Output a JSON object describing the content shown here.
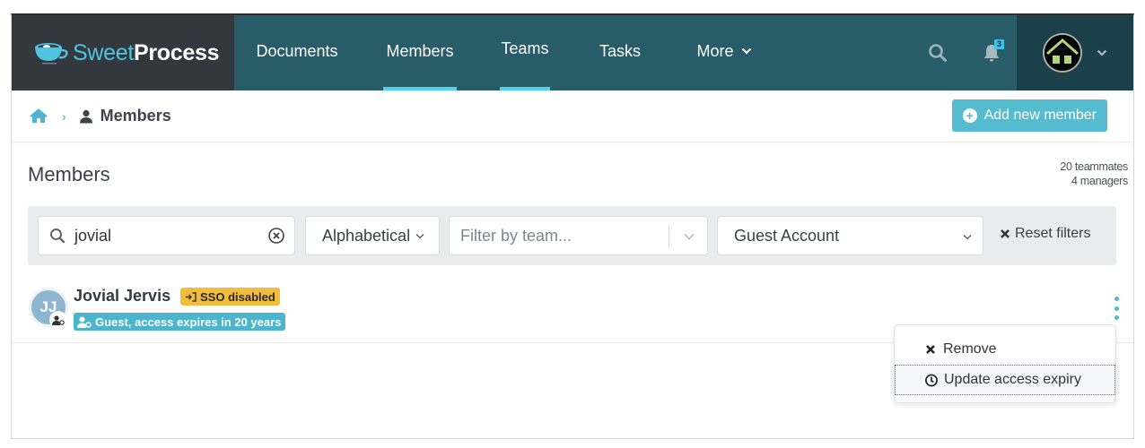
{
  "brand": {
    "name_light": "Sweet",
    "name_bold": "Process",
    "logo_icon": "coffee-cup-icon"
  },
  "nav": {
    "items": [
      {
        "label": "Documents",
        "active": false
      },
      {
        "label": "Members",
        "active": true
      },
      {
        "label": "Teams",
        "active": true
      },
      {
        "label": "Tasks",
        "active": false
      },
      {
        "label": "More",
        "active": false,
        "has_dropdown": true
      }
    ],
    "notification_count": "3",
    "accent_color": "#4fd2ee"
  },
  "breadcrumb": {
    "home_icon": "home-icon",
    "separator": "›",
    "current": "Members",
    "current_icon": "user-icon"
  },
  "actions": {
    "add_member_label": "Add new member"
  },
  "section": {
    "title": "Members",
    "teammates": "20 teammates",
    "managers": "4 managers"
  },
  "filters": {
    "search_value": "jovial",
    "sort_value": "Alphabetical",
    "team_placeholder": "Filter by team...",
    "account_value": "Guest Account",
    "reset_label": "Reset filters"
  },
  "members": [
    {
      "initials": "JJ",
      "name": "Jovial Jervis",
      "sso_badge": "SSO disabled",
      "guest_badge": "Guest, access expires in 20 years"
    }
  ],
  "menu": {
    "items": [
      {
        "label": "Remove",
        "icon": "x-icon"
      },
      {
        "label": "Update access expiry",
        "icon": "clock-icon"
      }
    ]
  },
  "colors": {
    "brand_bg": "#32383e",
    "nav_bg": "#275c68",
    "user_bg": "#1b4049",
    "primary_button": "#55bccf",
    "sso_badge": "#f2bd3c",
    "guest_badge": "#4ab5cd"
  }
}
